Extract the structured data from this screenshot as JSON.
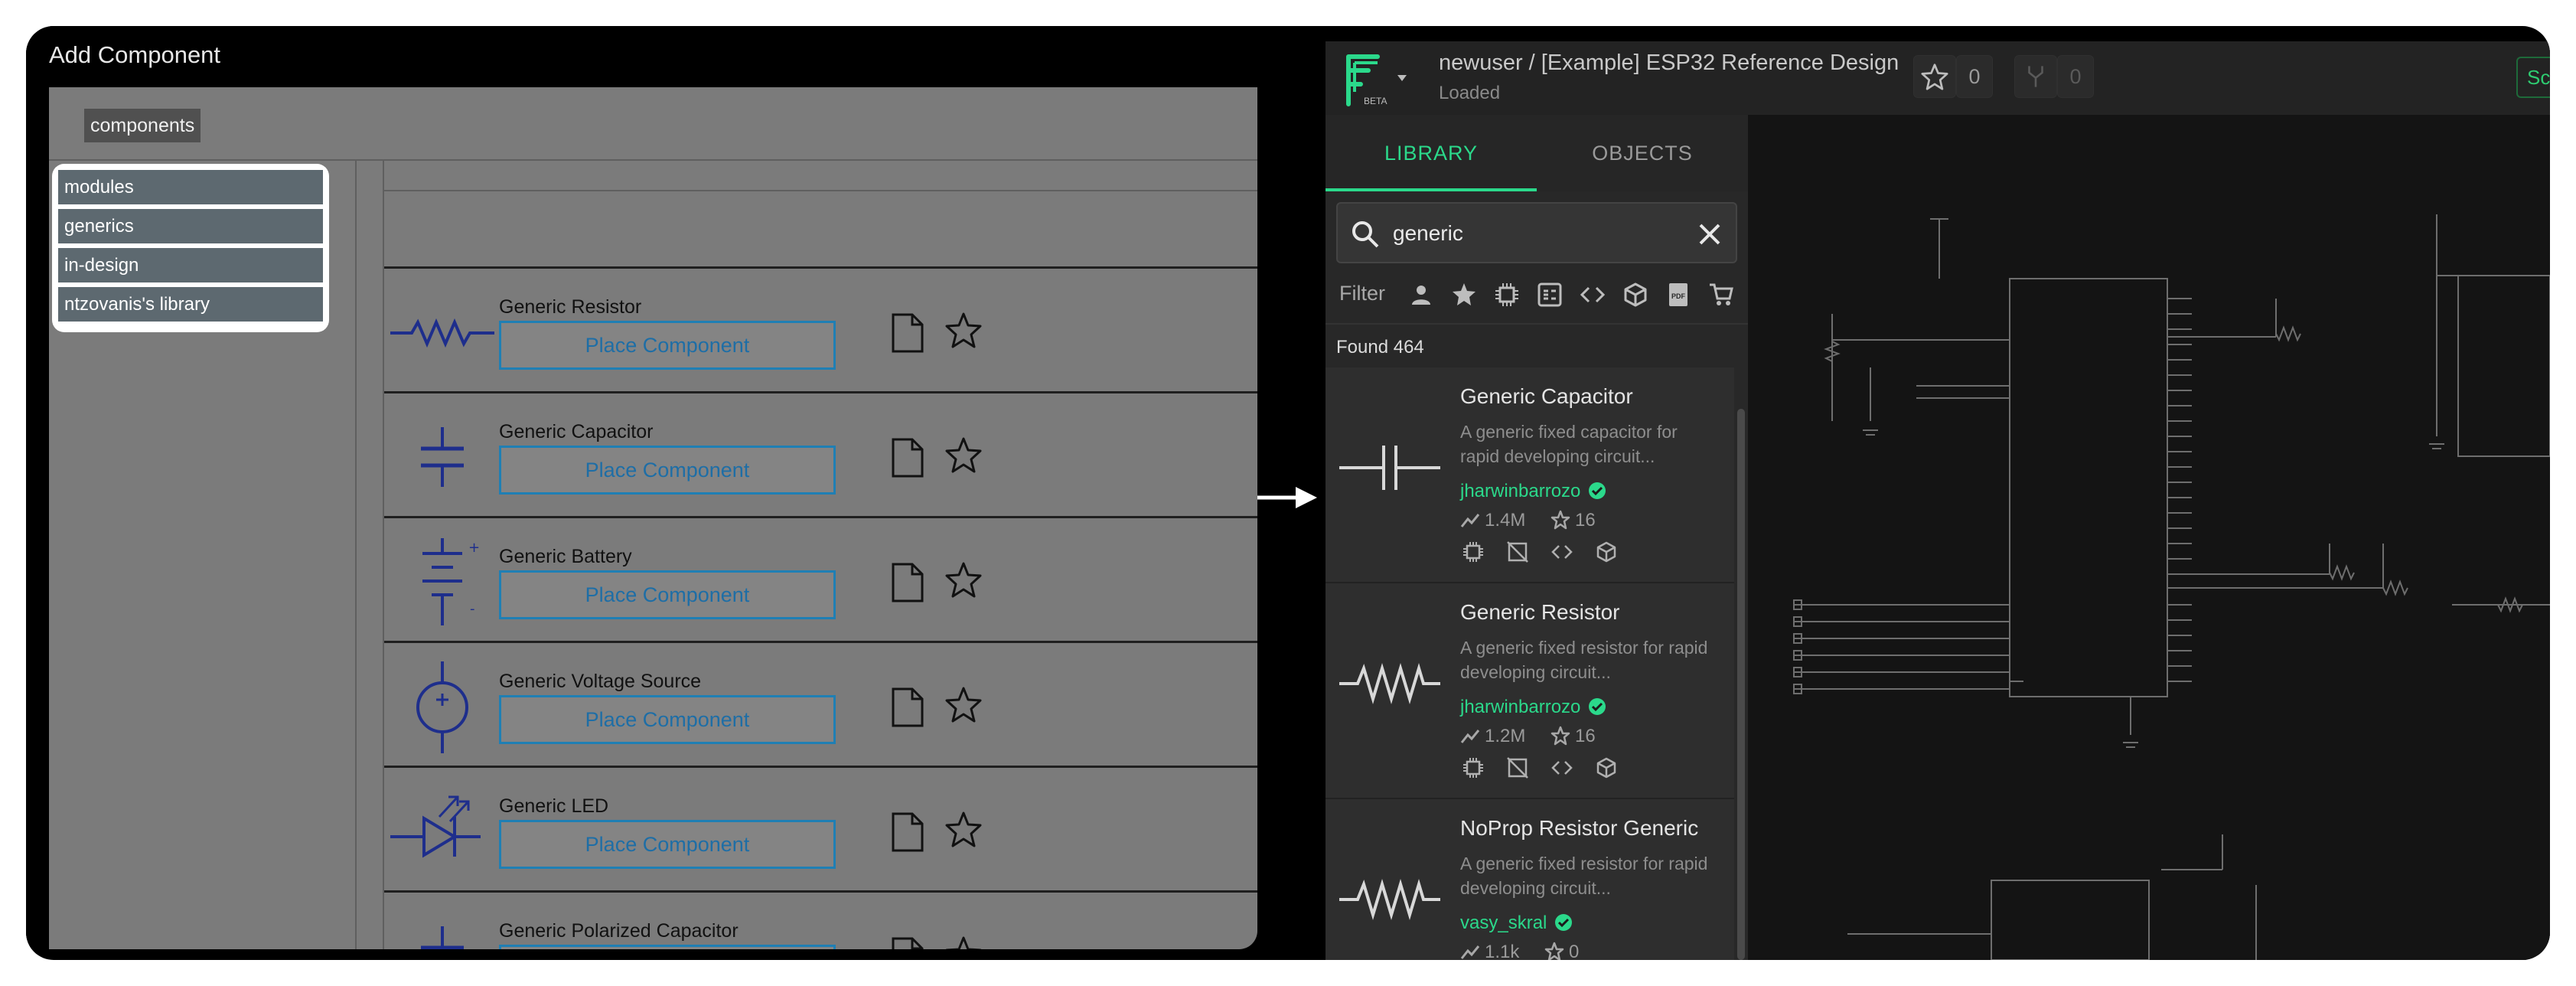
{
  "add_component": {
    "title": "Add Component",
    "breadcrumb": "components",
    "categories": [
      "modules",
      "generics",
      "in-design",
      "ntzovanis's library"
    ],
    "place_label": "Place Component",
    "items": [
      {
        "name": "Generic Resistor",
        "symbol": "resistor-icon"
      },
      {
        "name": "Generic Capacitor",
        "symbol": "capacitor-icon"
      },
      {
        "name": "Generic Battery",
        "symbol": "battery-icon"
      },
      {
        "name": "Generic Voltage Source",
        "symbol": "voltage-source-icon"
      },
      {
        "name": "Generic LED",
        "symbol": "led-icon"
      },
      {
        "name": "Generic Polarized Capacitor",
        "symbol": "polarized-capacitor-icon"
      }
    ],
    "symbol_color": "#1e2e8c",
    "place_border_color": "#1f7fb4"
  },
  "flux": {
    "project_title": "newuser / [Example] ESP32 Reference Design",
    "project_status": "Loaded",
    "logo_badge": "BETA",
    "star_count": "0",
    "fork_count": "0",
    "green_button": "Sc",
    "tabs": {
      "library": "LIBRARY",
      "objects": "OBJECTS"
    },
    "search": {
      "value": "generic"
    },
    "filter_label": "Filter",
    "found": "Found 464",
    "accent_color": "#2bd98b",
    "results": [
      {
        "title": "Generic Capacitor",
        "desc": "A generic fixed capacitor for rapid developing circuit...",
        "author": "jharwinbarrozo",
        "uses": "1.4M",
        "stars": "16",
        "symbol": "capacitor-icon"
      },
      {
        "title": "Generic Resistor",
        "desc": "A generic fixed resistor for rapid developing circuit...",
        "author": "jharwinbarrozo",
        "uses": "1.2M",
        "stars": "16",
        "symbol": "resistor-icon"
      },
      {
        "title": "NoProp Resistor Generic",
        "desc": "A generic fixed resistor for rapid developing circuit...",
        "author": "vasy_skral",
        "uses": "1.1k",
        "stars": "0",
        "symbol": "resistor-icon"
      }
    ]
  }
}
